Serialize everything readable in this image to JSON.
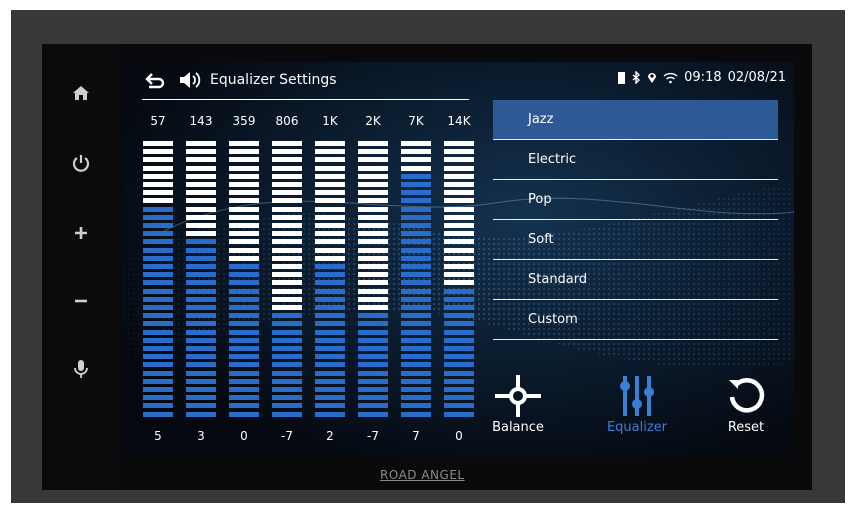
{
  "header": {
    "title": "Equalizer Settings",
    "time": "09:18",
    "date": "02/08/21"
  },
  "sidebar": {
    "icons": [
      "home-icon",
      "power-icon",
      "plus-icon",
      "minus-icon",
      "microphone-icon"
    ]
  },
  "equalizer": {
    "bands": [
      {
        "freq": "57",
        "gain": "5",
        "level": 0.75
      },
      {
        "freq": "143",
        "gain": "3",
        "level": 0.66
      },
      {
        "freq": "359",
        "gain": "0",
        "level": 0.55
      },
      {
        "freq": "806",
        "gain": "-7",
        "level": 0.38
      },
      {
        "freq": "1K",
        "gain": "2",
        "level": 0.55
      },
      {
        "freq": "2K",
        "gain": "-7",
        "level": 0.38
      },
      {
        "freq": "7K",
        "gain": "7",
        "level": 0.88
      },
      {
        "freq": "14K",
        "gain": "0",
        "level": 0.48
      }
    ]
  },
  "presets": {
    "items": [
      "Jazz",
      "Electric",
      "Pop",
      "Soft",
      "Standard",
      "Custom"
    ],
    "selected": "Jazz"
  },
  "controls": {
    "balance_label": "Balance",
    "equalizer_label": "Equalizer",
    "reset_label": "Reset"
  },
  "brand": "ROAD ANGEL",
  "colors": {
    "accent": "#2d5a96",
    "active_control": "#3a7fd6",
    "bar_blue": "#2a6cc9",
    "bar_white": "#ffffff"
  }
}
